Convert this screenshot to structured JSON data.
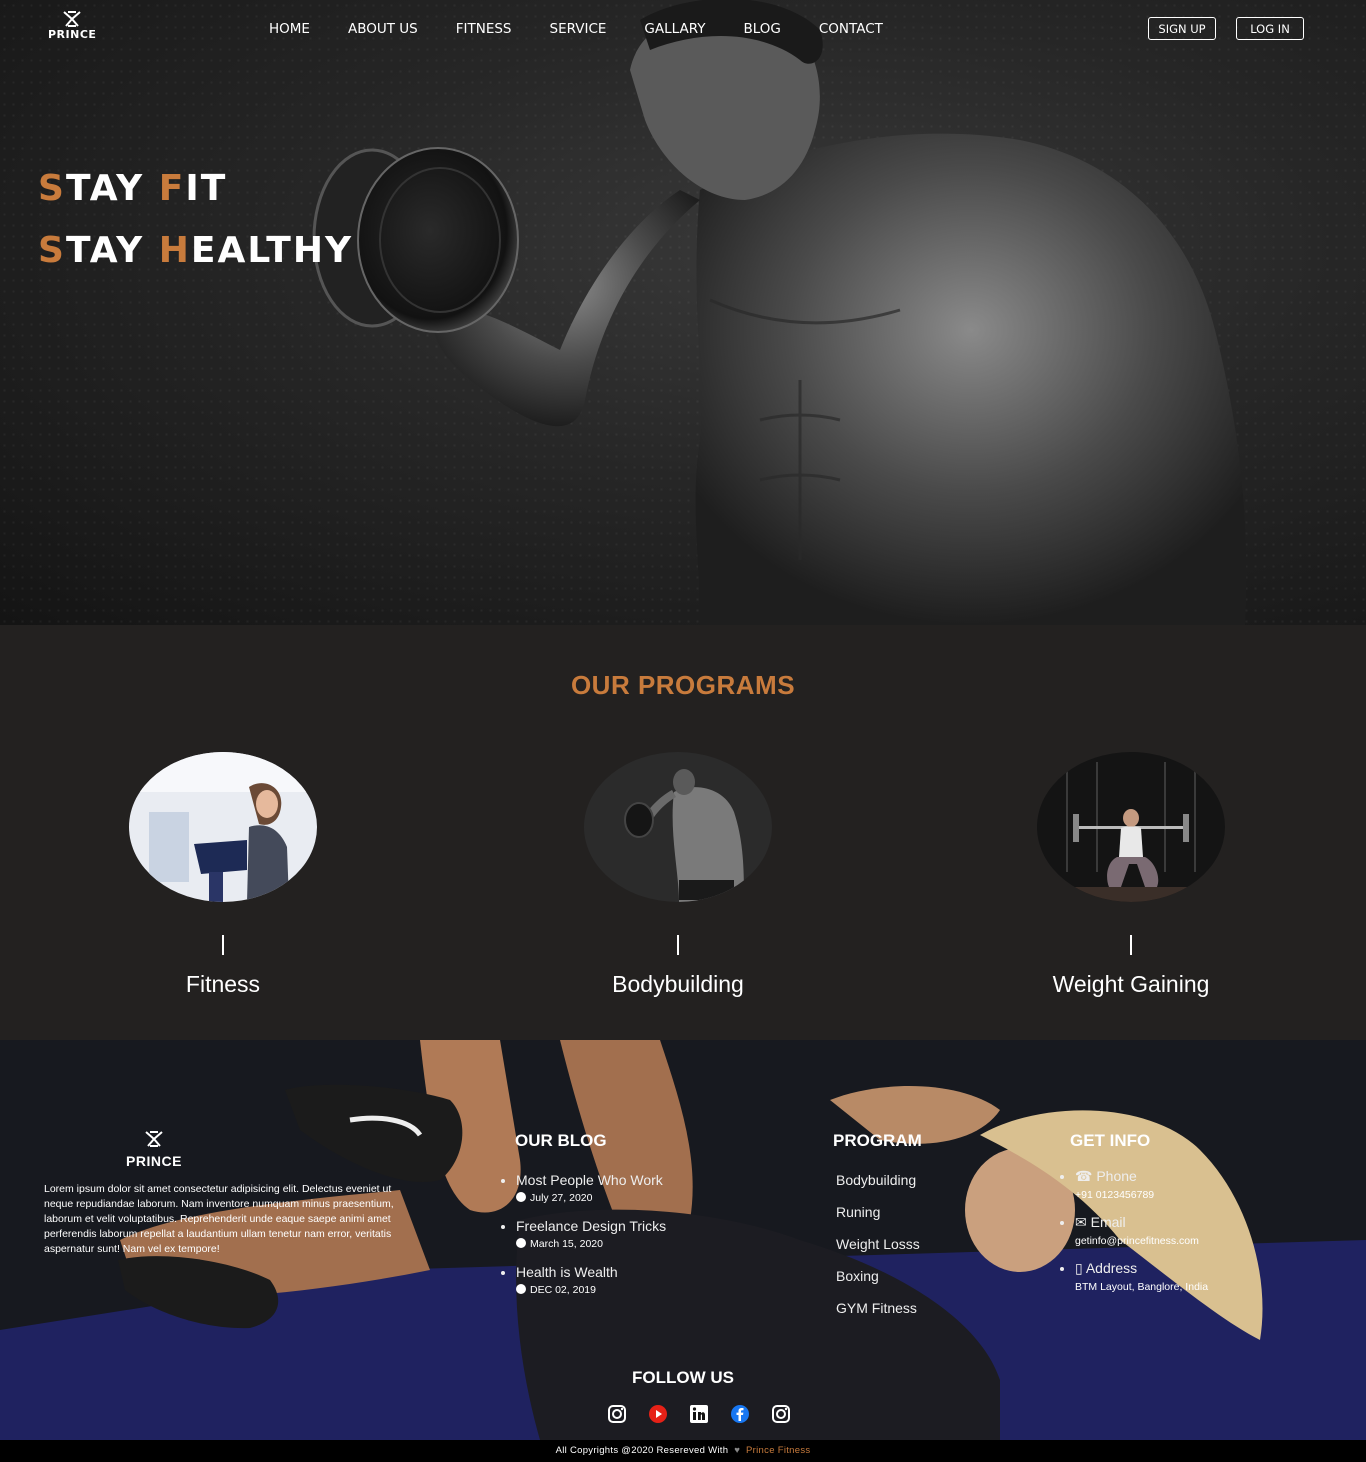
{
  "brand": {
    "name": "PRINCE"
  },
  "nav": {
    "items": [
      "HOME",
      "ABOUT US",
      "FITNESS",
      "SERVICE",
      "GALLARY",
      "BLOG",
      "CONTACT"
    ],
    "signup": "SIGN UP",
    "login": "LOG IN"
  },
  "hero": {
    "line1": {
      "first_a": "S",
      "rest_a": "TAY ",
      "first_b": "F",
      "rest_b": "IT"
    },
    "line2": {
      "first_a": "S",
      "rest_a": "TAY ",
      "first_b": "H",
      "rest_b": "EALTHY"
    }
  },
  "programs": {
    "title": "OUR PROGRAMS",
    "items": [
      {
        "name": "Fitness"
      },
      {
        "name": "Bodybuilding"
      },
      {
        "name": "Weight Gaining"
      }
    ]
  },
  "footer": {
    "about": "Lorem ipsum dolor sit amet consectetur adipisicing elit. Delectus eveniet ut neque repudiandae laborum. Nam inventore numquam minus praesentium, laborum et velit voluptatibus. Reprehenderit unde eaque saepe animi amet perferendis laborum repellat a laudantium ullam tenetur nam error, veritatis aspernatur sunt! Nam vel ex tempore!",
    "blog_title": "OUR BLOG",
    "blog": [
      {
        "title": "Most People Who Work",
        "date": "July 27, 2020"
      },
      {
        "title": "Freelance Design Tricks",
        "date": "March 15, 2020"
      },
      {
        "title": "Health is Wealth",
        "date": "DEC 02, 2019"
      }
    ],
    "program_title": "PROGRAM",
    "program_list": [
      "Bodybuilding",
      "Runing",
      "Weight Losss",
      "Boxing",
      "GYM Fitness"
    ],
    "info_title": "GET INFO",
    "info": [
      {
        "label": "Phone",
        "value": "+91 0123456789"
      },
      {
        "label": "Email",
        "value": "getinfo@princefitness.com"
      },
      {
        "label": "Address",
        "value": "BTM Layout, Banglore, India"
      }
    ],
    "follow_title": "FOLLOW US",
    "socials": [
      "instagram-icon",
      "youtube-icon",
      "linkedin-icon",
      "facebook-icon",
      "instagram-icon"
    ]
  },
  "copyright": {
    "text": "All Copyrights @2020 Resereved With",
    "brand": "Prince Fitness"
  },
  "colors": {
    "accent": "#c87b3c",
    "programs_bg": "#232120",
    "footer_bg": "#161821"
  }
}
